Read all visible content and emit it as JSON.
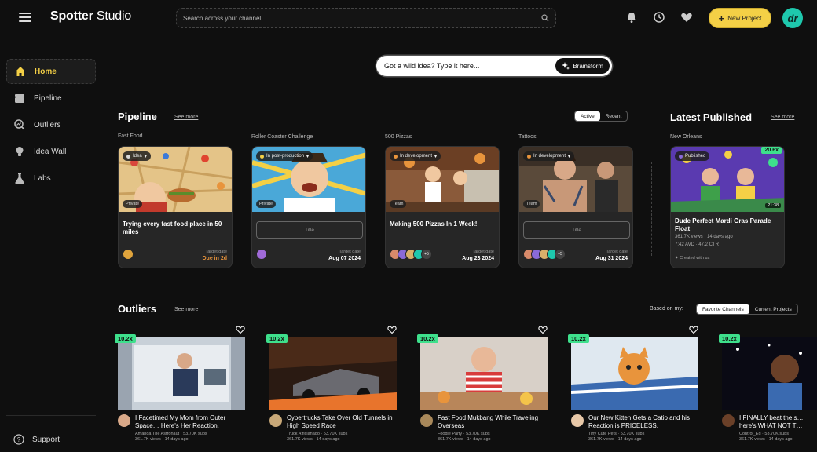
{
  "app": {
    "brand_bold": "Spotter",
    "brand_light": " Studio",
    "search_placeholder": "Search across your channel",
    "new_project": "New Project",
    "avatar_initials": "dr"
  },
  "sidebar": {
    "items": [
      {
        "label": "Home",
        "icon": "home-icon"
      },
      {
        "label": "Pipeline",
        "icon": "pipeline-icon"
      },
      {
        "label": "Outliers",
        "icon": "outliers-icon"
      },
      {
        "label": "Idea Wall",
        "icon": "lightbulb-icon"
      },
      {
        "label": "Labs",
        "icon": "flask-icon"
      }
    ],
    "support": "Support"
  },
  "brainstorm": {
    "placeholder": "Got a wild idea? Type it here...",
    "button": "Brainstorm"
  },
  "pipeline": {
    "title": "Pipeline",
    "see_more": "See more",
    "toggle": [
      "Active",
      "Recent"
    ],
    "cards": [
      {
        "group": "Fast Food",
        "status": "Idea",
        "status_color": "#d9d9d9",
        "visibility": "Private",
        "title": "Trying every fast food place in 50 miles",
        "target_label": "Target date",
        "target": "Due in 2d"
      },
      {
        "group": "Roller Coaster Challenge",
        "status": "In post-production",
        "status_color": "#f4d046",
        "visibility": "Private",
        "title_placeholder": "Title",
        "target_label": "Target date",
        "target": "Aug 07 2024"
      },
      {
        "group": "500 Pizzas",
        "status": "In development",
        "status_color": "#e8943c",
        "visibility": "Team",
        "title": "Making 500 Pizzas In 1 Week!",
        "target_label": "Target date",
        "target": "Aug 23 2024",
        "extra": "+5"
      },
      {
        "group": "Tattoos",
        "status": "In development",
        "status_color": "#e8943c",
        "visibility": "Team",
        "title_placeholder": "Title",
        "target_label": "Target date",
        "target": "Aug 31 2024",
        "extra": "+5"
      }
    ]
  },
  "latest": {
    "title": "Latest Published",
    "see_more": "See more",
    "group": "New Orleans",
    "status": "Published",
    "badge": "20.6x",
    "duration": "21:38",
    "video_title": "Dude Perfect Mardi Gras Parade Float",
    "views": "361.7K views",
    "ago": "14 days ago",
    "avd": "7:42 AVD",
    "ctr": "47.2 CTR",
    "credit": "Created with us"
  },
  "outliers": {
    "title": "Outliers",
    "see_more": "See more",
    "based_on": "Based on my:",
    "toggle": [
      "Favorite Channels",
      "Current Projects"
    ],
    "items": [
      {
        "badge": "10.2x",
        "title": "I Facetimed My Mom from Outer Space… Here's Her Reaction.",
        "channel": "Amanda The Astronaut",
        "subs": "53.70K subs",
        "views": "361.7K views",
        "ago": "14 days ago"
      },
      {
        "badge": "10.2x",
        "title": "Cybertrucks Take Over Old Tunnels in High Speed Race",
        "channel": "Truck Afficianado",
        "subs": "53.70K subs",
        "views": "361.7K views",
        "ago": "14 days ago"
      },
      {
        "badge": "10.2x",
        "title": "Fast Food Mukbang While Traveling Overseas",
        "channel": "Foodie Party",
        "subs": "53.70K subs",
        "views": "361.7K views",
        "ago": "14 days ago"
      },
      {
        "badge": "10.2x",
        "title": "Our New Kitten Gets a Catio and his Reaction is PRICELESS.",
        "channel": "Tiny Cute Pets",
        "subs": "53.70K subs",
        "views": "361.7K views",
        "ago": "14 days ago"
      },
      {
        "badge": "10.2x",
        "title": "I FINALLY beat the s… here's WHAT NOT T…",
        "channel": "Control_Ed",
        "subs": "53.70K subs",
        "views": "361.7K views",
        "ago": "14 days ago"
      }
    ]
  },
  "colors": {
    "accent": "#f4d046",
    "outlier": "#3ee08c",
    "avatar": "#1ec8ad",
    "due": "#e8943c"
  }
}
